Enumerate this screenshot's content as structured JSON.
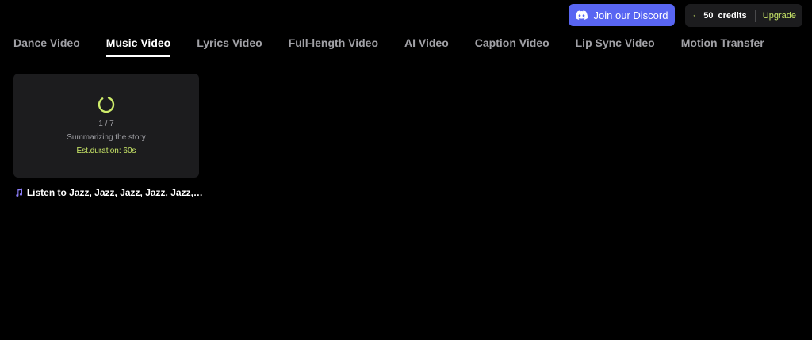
{
  "header": {
    "discord_label": "Join our Discord",
    "credits_count": "50",
    "credits_label": "credits",
    "upgrade_label": "Upgrade"
  },
  "tabs": [
    {
      "label": "Dance Video",
      "active": false
    },
    {
      "label": "Music Video",
      "active": true
    },
    {
      "label": "Lyrics Video",
      "active": false
    },
    {
      "label": "Full-length Video",
      "active": false
    },
    {
      "label": "AI Video",
      "active": false
    },
    {
      "label": "Caption Video",
      "active": false
    },
    {
      "label": "Lip Sync Video",
      "active": false
    },
    {
      "label": "Motion Transfer",
      "active": false
    }
  ],
  "card": {
    "progress": "1 / 7",
    "status": "Summarizing the story",
    "eta": "Est.duration: 60s",
    "title": "Listen to Jazz, Jazz, Jazz, Jazz, Jazz, Jazz,..."
  },
  "colors": {
    "discord": "#5865f2",
    "accent": "#cdeb6a",
    "card_bg": "#1c1c1e",
    "note_icon": "#8b7cf6"
  },
  "icons": {
    "discord": "discord-icon",
    "credits": "sparkle-icon",
    "spinner": "loading-spinner-icon",
    "title": "music-note-icon"
  }
}
